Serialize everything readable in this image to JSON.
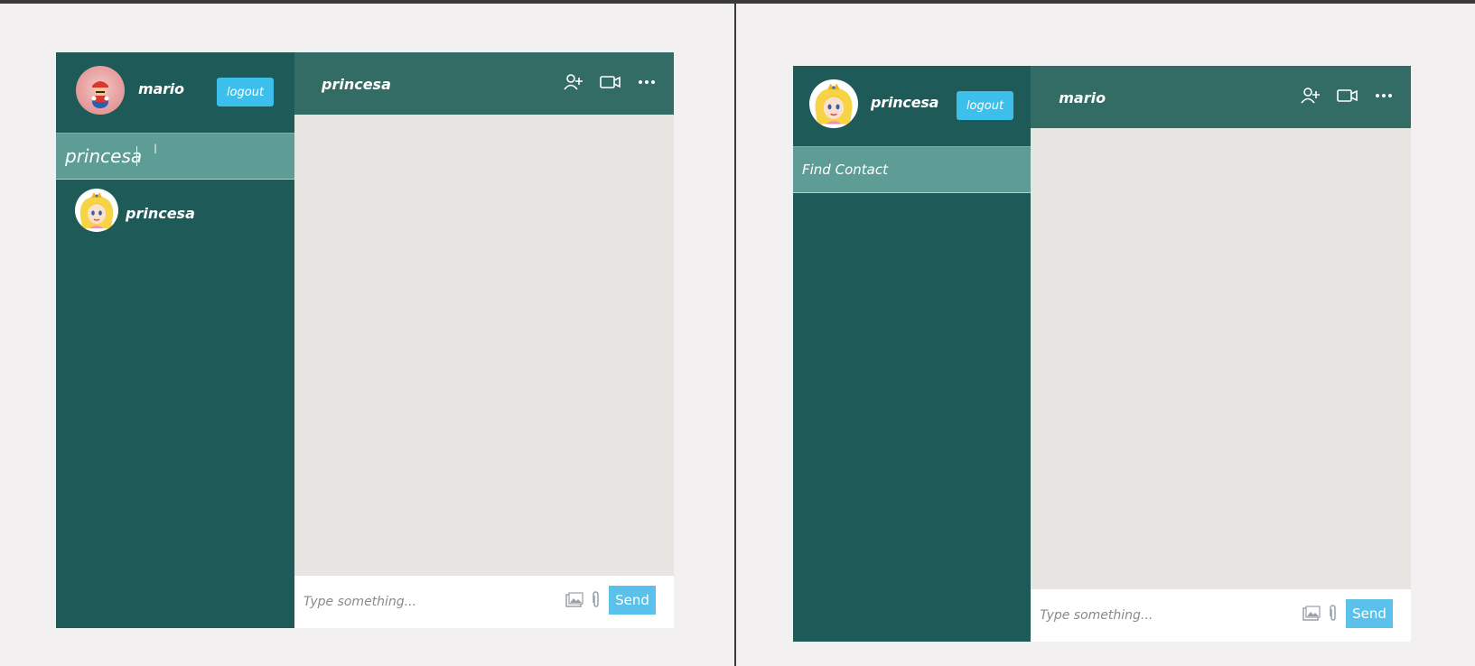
{
  "left_window": {
    "current_user": {
      "name": "mario",
      "avatar": "mario-avatar"
    },
    "logout_label": "logout",
    "search": {
      "value": "princesa",
      "placeholder": "Find Contact"
    },
    "contacts": [
      {
        "name": "princesa",
        "avatar": "peach-avatar"
      }
    ],
    "chat": {
      "title": "princesa",
      "icons": [
        "add-user-icon",
        "video-call-icon",
        "more-options-icon"
      ],
      "input_placeholder": "Type something...",
      "input_icons": [
        "image-icon",
        "attach-icon"
      ],
      "send_label": "Send"
    }
  },
  "right_window": {
    "current_user": {
      "name": "princesa",
      "avatar": "peach-avatar"
    },
    "logout_label": "logout",
    "search": {
      "value": "",
      "placeholder": "Find Contact"
    },
    "contacts": [],
    "chat": {
      "title": "mario",
      "icons": [
        "add-user-icon",
        "video-call-icon",
        "more-options-icon"
      ],
      "input_placeholder": "Type something...",
      "input_icons": [
        "image-icon",
        "attach-icon"
      ],
      "send_label": "Send"
    }
  },
  "colors": {
    "sidebar": "#1e5a57",
    "chat_header": "#336b65",
    "search_row": "#5e9d96",
    "chat_body": "#e6e5e2",
    "accent_button": "#3cbfea",
    "page_background": "#f2f0f1"
  }
}
